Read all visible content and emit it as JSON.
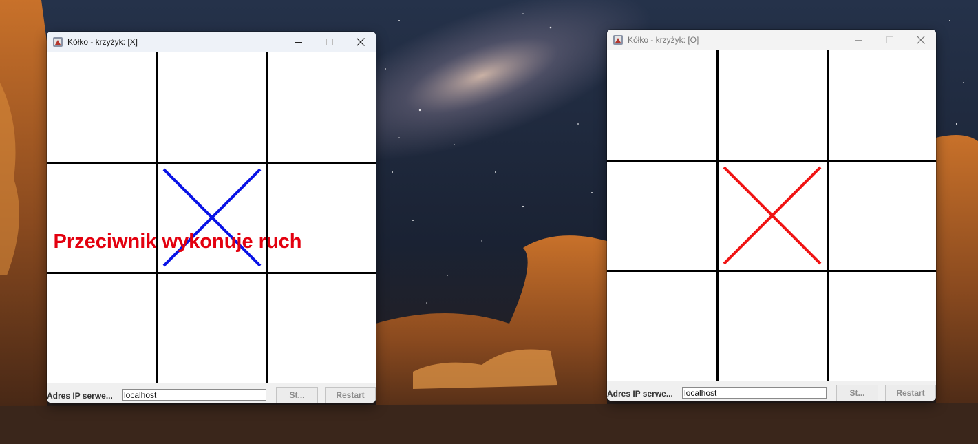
{
  "windows": [
    {
      "title": "Kółko - krzyżyk: [X]",
      "board": [
        "",
        "",
        "",
        "",
        "X",
        "",
        "",
        "",
        ""
      ],
      "mark_color": "#0a14e6",
      "status_message": "Przeciwnik wykonuje ruch",
      "ip_label": "Adres IP serwe...",
      "ip_value": "localhost",
      "start_label": "St...",
      "restart_label": "Restart"
    },
    {
      "title": "Kółko - krzyżyk: [O]",
      "board": [
        "",
        "",
        "",
        "",
        "X",
        "",
        "",
        "",
        ""
      ],
      "mark_color": "#f01414",
      "status_message": "",
      "ip_label": "Adres IP serwe...",
      "ip_value": "localhost",
      "start_label": "St...",
      "restart_label": "Restart"
    }
  ],
  "colors": {
    "status": "#e3000f",
    "grid": "#000000"
  },
  "icons": [
    "java-app-icon",
    "minimize-icon",
    "maximize-icon",
    "close-icon"
  ]
}
